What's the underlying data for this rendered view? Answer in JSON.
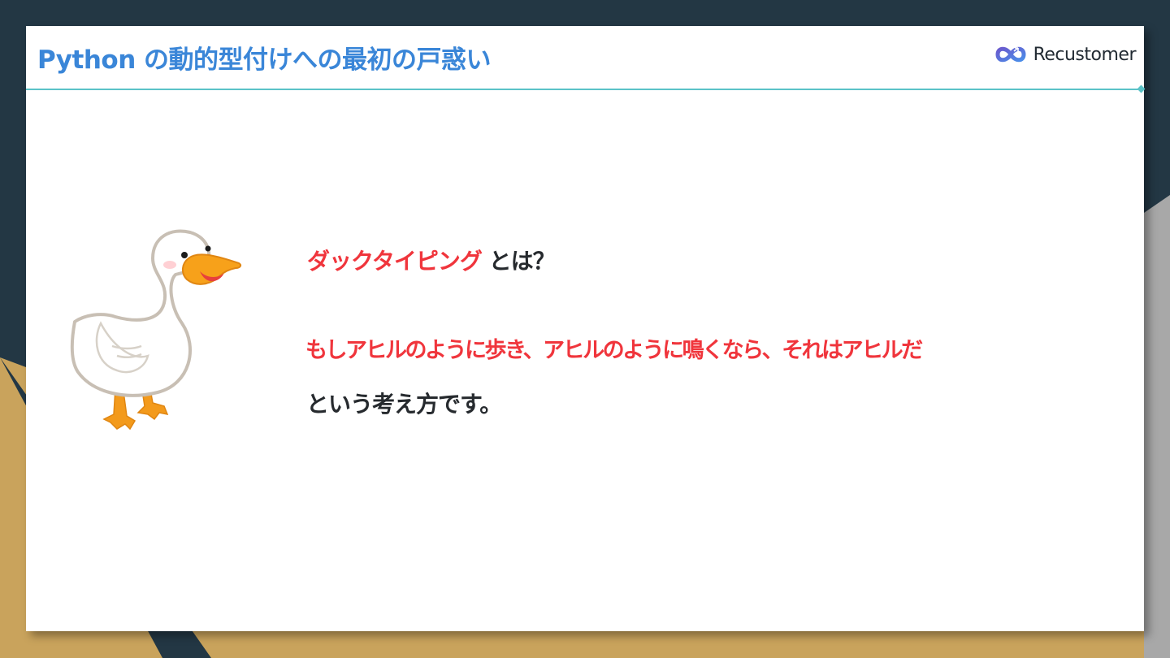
{
  "slide": {
    "title": "Python の動的型付けへの最初の戸惑い",
    "logo_text": "Recustomer",
    "question_term": "ダックタイピング",
    "question_rest": " とは？",
    "definition": "もしアヒルのように歩き、アヒルのように鳴くなら、それはアヒルだ",
    "conclusion": "という考え方です。"
  },
  "icons": {
    "logo": "recustomer-logo-icon",
    "illustration": "duck-illustration-icon"
  },
  "colors": {
    "background_dark": "#233744",
    "background_gold": "#c9a35c",
    "title_blue": "#3a86d8",
    "accent_teal": "#5bc3c8",
    "emphasis_red": "#f0353c",
    "text_dark": "#262a2e"
  }
}
